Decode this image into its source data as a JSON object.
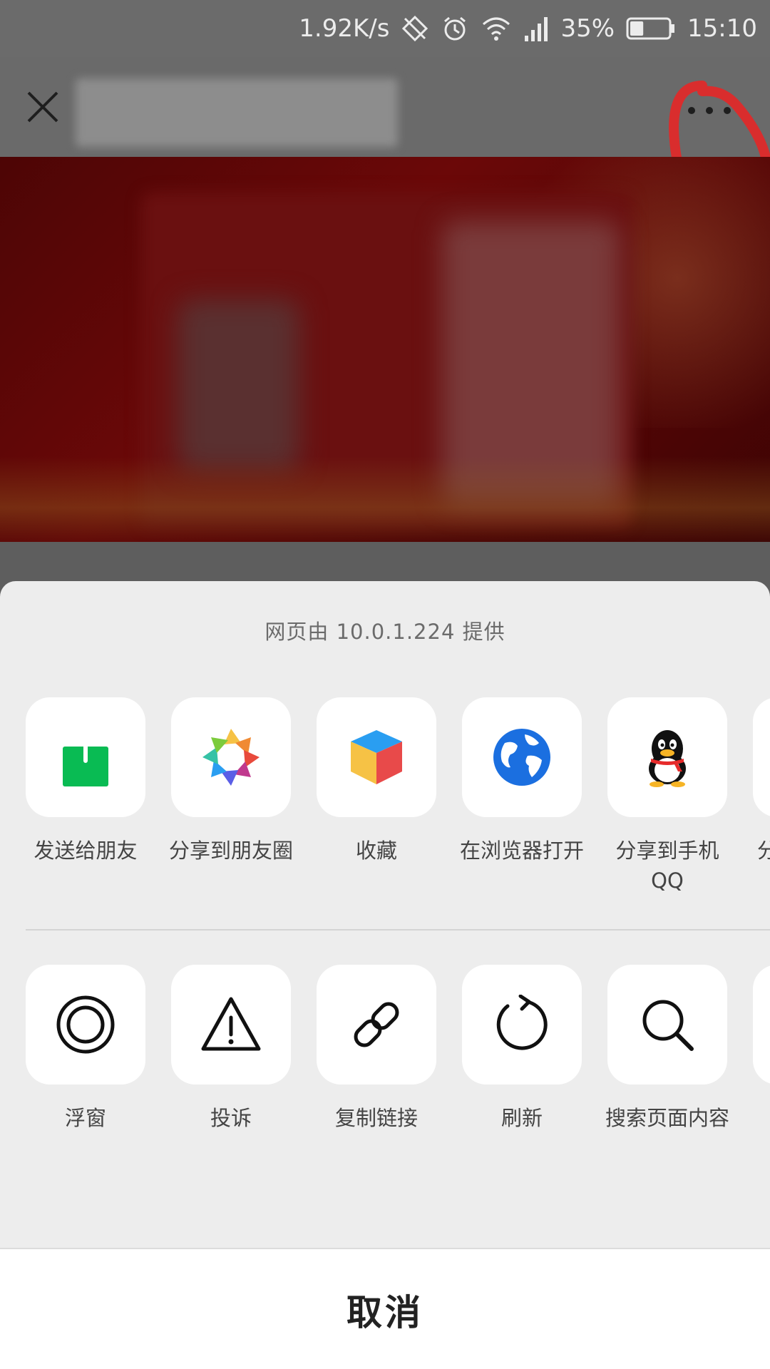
{
  "status_bar": {
    "net_speed": "1.92K/s",
    "battery_percent": "35%",
    "battery_level": 0.35,
    "time": "15:10",
    "icons": [
      "sync-off-icon",
      "alarm-icon",
      "wifi-icon",
      "signal-icon",
      "battery-icon"
    ]
  },
  "top_bar": {
    "close_icon": "close-icon",
    "more_icon": "more-icon"
  },
  "sheet": {
    "provider_text": "网页由 10.0.1.224 提供",
    "share_items": [
      {
        "label": "发送给朋友",
        "icon": "send-to-friend-icon"
      },
      {
        "label": "分享到朋友圈",
        "icon": "moments-icon"
      },
      {
        "label": "收藏",
        "icon": "favorite-icon"
      },
      {
        "label": "在浏览器打开",
        "icon": "browser-icon"
      },
      {
        "label": "分享到手机QQ",
        "icon": "qq-icon"
      },
      {
        "label": "分",
        "icon": ""
      }
    ],
    "action_items": [
      {
        "label": "浮窗",
        "icon": "float-window-icon"
      },
      {
        "label": "投诉",
        "icon": "warning-icon"
      },
      {
        "label": "复制链接",
        "icon": "link-icon"
      },
      {
        "label": "刷新",
        "icon": "refresh-icon"
      },
      {
        "label": "搜索页面内容",
        "icon": "search-icon"
      },
      {
        "label": "",
        "icon": ""
      }
    ],
    "cancel_label": "取消"
  },
  "colors": {
    "moments_green": "#1aad19",
    "share_green": "#09bb53",
    "qq_red": "#e62a2a",
    "browser_blue": "#1b6fe0",
    "annotation_red": "#d92d2d"
  }
}
